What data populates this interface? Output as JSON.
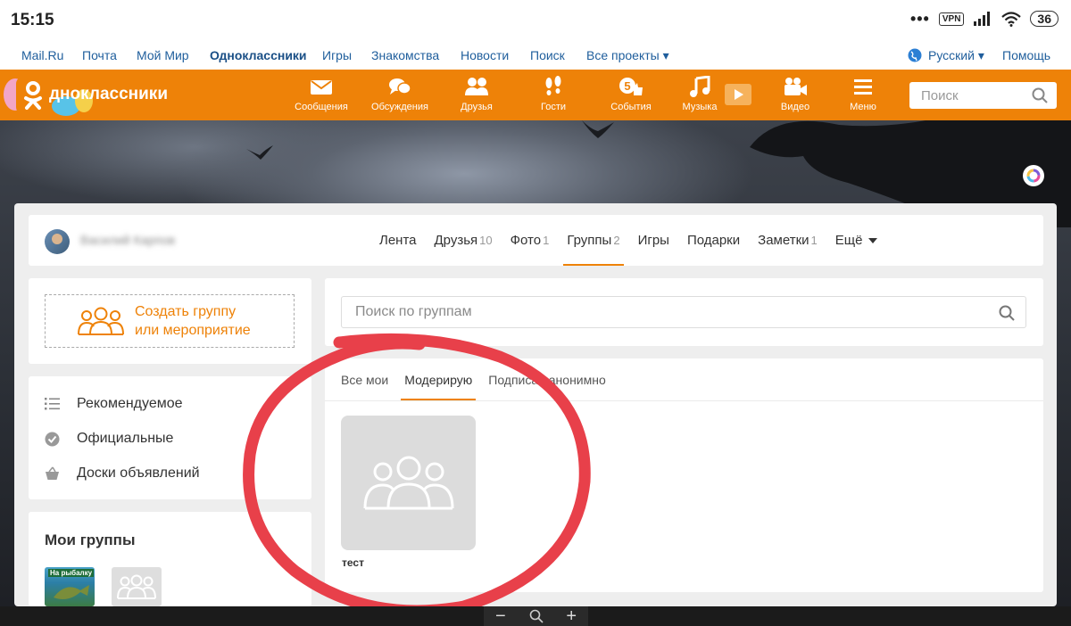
{
  "status_bar": {
    "time": "15:15",
    "dots": "•••",
    "vpn": "VPN",
    "battery": "36"
  },
  "portal": {
    "links": [
      "Mail.Ru",
      "Почта",
      "Мой Мир",
      "Одноклассники",
      "Игры",
      "Знакомства",
      "Новости",
      "Поиск",
      "Все проекты ▾"
    ],
    "language": "Русский ▾",
    "help": "Помощь"
  },
  "header": {
    "logo_text": "дноклассники",
    "nav": [
      "Сообщения",
      "Обсуждения",
      "Друзья",
      "Гости",
      "События",
      "Музыка",
      "Видео",
      "Меню"
    ],
    "events_badge": "5",
    "search_placeholder": "Поиск",
    "brand_color": "#ee8208"
  },
  "profile": {
    "username": "Василий Карпов",
    "tabs": [
      {
        "label": "Лента",
        "count": ""
      },
      {
        "label": "Друзья",
        "count": "10"
      },
      {
        "label": "Фото",
        "count": "1"
      },
      {
        "label": "Группы",
        "count": "2"
      },
      {
        "label": "Игры",
        "count": ""
      },
      {
        "label": "Подарки",
        "count": ""
      },
      {
        "label": "Заметки",
        "count": "1"
      },
      {
        "label": "Ещё",
        "count": ""
      }
    ]
  },
  "sidebar": {
    "create_line1": "Создать группу",
    "create_line2": "или мероприятие",
    "categories": [
      "Рекомендуемое",
      "Официальные",
      "Доски объявлений"
    ],
    "my_groups_title": "Мои группы",
    "thumb_label": "На рыбалку"
  },
  "groups": {
    "search_placeholder": "Поиск по группам",
    "tabs": [
      "Все мои",
      "Модерирую",
      "Подписан анонимно"
    ],
    "items": [
      {
        "name": "тест"
      }
    ]
  },
  "zoom": {
    "minus": "−",
    "plus": "+"
  }
}
